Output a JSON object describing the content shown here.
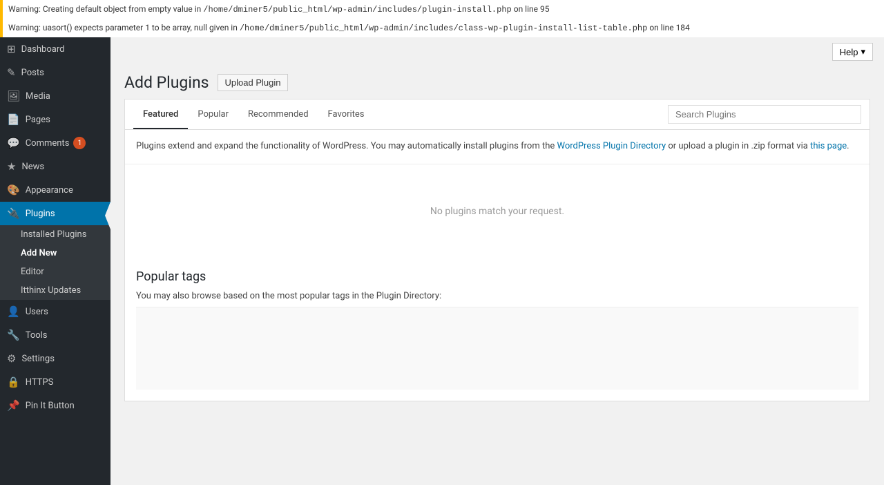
{
  "warnings": [
    {
      "text": "Warning: Creating default object from empty value in ",
      "file": "/home/dminer5/public_html/wp-admin/includes/plugin-install.php",
      "line": "on line 95"
    },
    {
      "text": "Warning: uasort() expects parameter 1 to be array, null given in ",
      "file": "/home/dminer5/public_html/wp-admin/includes/class-wp-plugin-install-list-table.php",
      "line": "on line 184"
    }
  ],
  "header": {
    "help_label": "Help",
    "help_arrow": "▾"
  },
  "page": {
    "title": "Add Plugins",
    "upload_button": "Upload Plugin"
  },
  "tabs": [
    {
      "id": "featured",
      "label": "Featured",
      "active": true
    },
    {
      "id": "popular",
      "label": "Popular",
      "active": false
    },
    {
      "id": "recommended",
      "label": "Recommended",
      "active": false
    },
    {
      "id": "favorites",
      "label": "Favorites",
      "active": false
    }
  ],
  "search": {
    "placeholder": "Search Plugins"
  },
  "description": {
    "text1": "Plugins extend and expand the functionality of WordPress. You may automatically install plugins from the ",
    "link1": "WordPress Plugin Directory",
    "text2": " or upload a plugin in .zip format via ",
    "link2": "this page",
    "text3": "."
  },
  "no_plugins_message": "No plugins match your request.",
  "popular_tags": {
    "title": "Popular tags",
    "description": "You may also browse based on the most popular tags in the Plugin Directory:"
  },
  "sidebar": {
    "items": [
      {
        "id": "dashboard",
        "label": "Dashboard",
        "icon": "⊞",
        "active": false
      },
      {
        "id": "posts",
        "label": "Posts",
        "icon": "✎",
        "active": false
      },
      {
        "id": "media",
        "label": "Media",
        "icon": "🖼",
        "active": false
      },
      {
        "id": "pages",
        "label": "Pages",
        "icon": "📄",
        "active": false
      },
      {
        "id": "comments",
        "label": "Comments",
        "icon": "💬",
        "badge": "1",
        "active": false
      },
      {
        "id": "news",
        "label": "News",
        "icon": "★",
        "active": false
      },
      {
        "id": "appearance",
        "label": "Appearance",
        "icon": "🎨",
        "active": false
      },
      {
        "id": "plugins",
        "label": "Plugins",
        "icon": "🔌",
        "active": true
      },
      {
        "id": "users",
        "label": "Users",
        "icon": "👤",
        "active": false
      },
      {
        "id": "tools",
        "label": "Tools",
        "icon": "🔧",
        "active": false
      },
      {
        "id": "settings",
        "label": "Settings",
        "icon": "⚙",
        "active": false
      },
      {
        "id": "https",
        "label": "HTTPS",
        "icon": "🔒",
        "active": false
      },
      {
        "id": "pin-it-button",
        "label": "Pin It Button",
        "icon": "📌",
        "active": false
      }
    ],
    "plugins_submenu": [
      {
        "id": "installed-plugins",
        "label": "Installed Plugins",
        "active": false
      },
      {
        "id": "add-new",
        "label": "Add New",
        "active": true
      },
      {
        "id": "editor",
        "label": "Editor",
        "active": false
      },
      {
        "id": "itthinx-updates",
        "label": "Itthinx Updates",
        "active": false
      }
    ]
  }
}
